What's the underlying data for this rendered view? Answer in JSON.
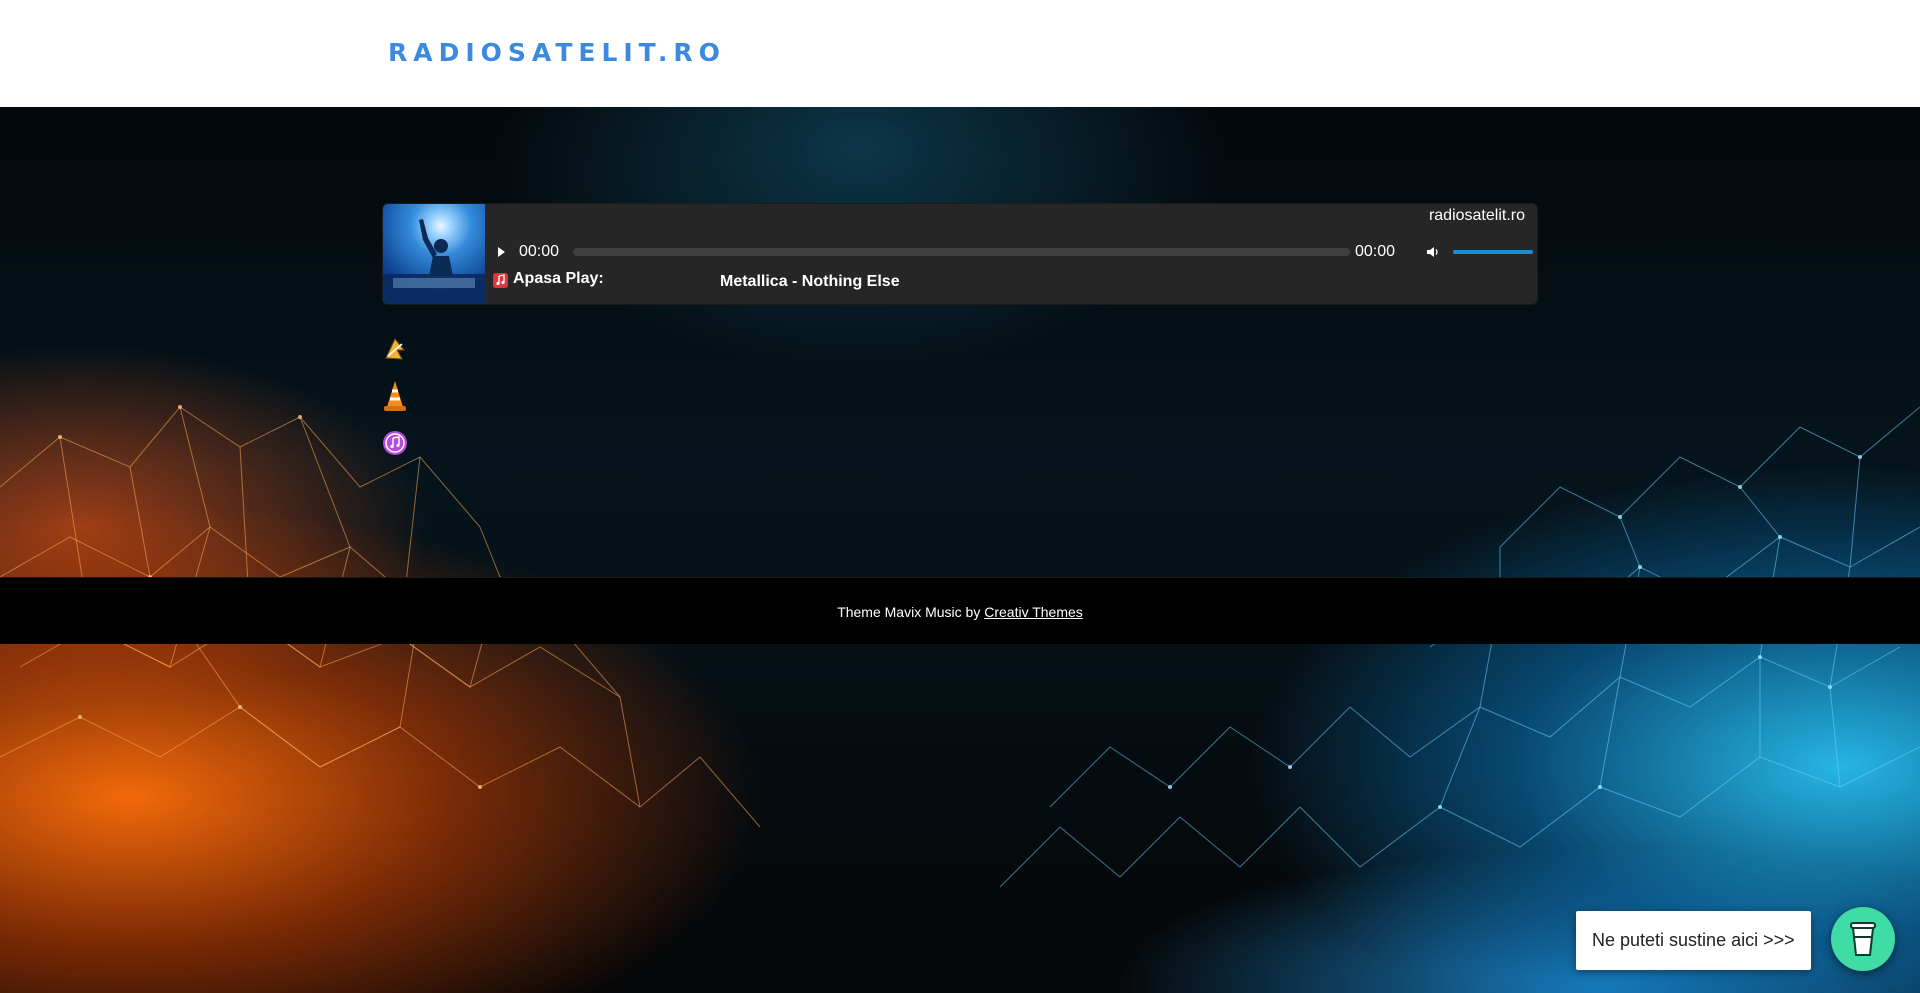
{
  "header": {
    "site_title": "RADIOSATELIT.RO"
  },
  "player": {
    "station": "radiosatelit.ro",
    "current_time": "00:00",
    "duration": "00:00",
    "volume": 1.0,
    "now_playing_label": "Apasa Play:",
    "track": "Metallica - Nothing Else",
    "icons": [
      "play-icon",
      "volume-icon",
      "music-note-icon"
    ]
  },
  "side_icons": [
    "winamp-icon",
    "vlc-icon",
    "itunes-icon"
  ],
  "footer": {
    "text": "Theme Mavix Music by ",
    "link": "Creativ Themes"
  },
  "support": {
    "bubble_text": "Ne puteti sustine aici >>>",
    "button_icon": "coffee-cup-icon"
  },
  "colors": {
    "brand": "#3c8ae0",
    "player_bg": "#262626",
    "volume_accent": "#1a8ad1",
    "support_button": "#40dca5"
  }
}
